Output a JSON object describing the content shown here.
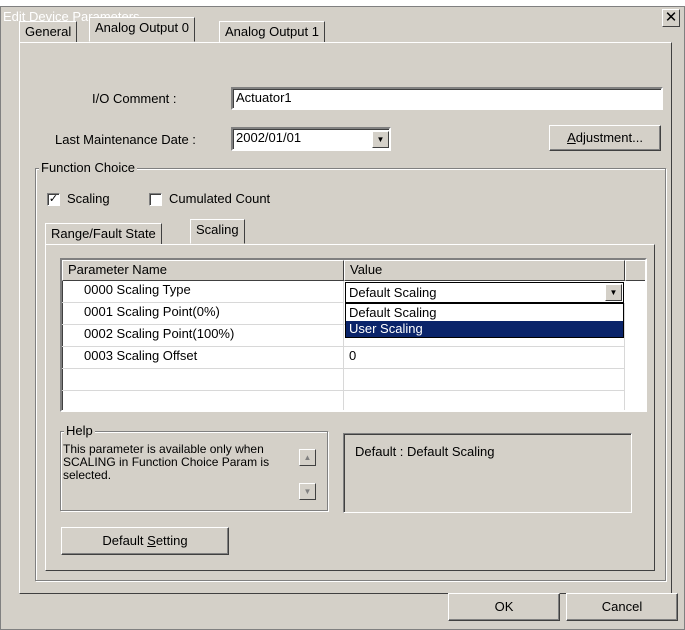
{
  "window": {
    "title": "Edit Device Parameters",
    "close_glyph": "✕"
  },
  "tabs": [
    {
      "label": "General"
    },
    {
      "label": "Analog Output 0"
    },
    {
      "label": "Analog Output 1"
    }
  ],
  "io_comment": {
    "label": "I/O Comment :",
    "value": "Actuator1"
  },
  "maintenance": {
    "label": "Last Maintenance Date :",
    "value": "2002/01/01"
  },
  "adjustment_button": {
    "before": "",
    "accel": "A",
    "after": "djustment..."
  },
  "function_choice": {
    "title": "Function Choice",
    "scaling": {
      "label": "Scaling",
      "checked": true,
      "check_glyph": "✓"
    },
    "cumulated": {
      "label": "Cumulated Count",
      "checked": false
    }
  },
  "subtabs": [
    {
      "label": "Range/Fault State"
    },
    {
      "label": "Scaling"
    }
  ],
  "grid": {
    "headers": [
      "Parameter Name",
      "Value"
    ],
    "rows": [
      {
        "name": "0000 Scaling Type",
        "value": "Default Scaling"
      },
      {
        "name": "0001 Scaling Point(0%)",
        "value": ""
      },
      {
        "name": "0002 Scaling Point(100%)",
        "value": ""
      },
      {
        "name": "0003 Scaling Offset",
        "value": "0"
      }
    ],
    "dropdown_options": [
      "Default Scaling",
      "User Scaling"
    ],
    "highlighted_option": "User Scaling"
  },
  "help": {
    "title": "Help",
    "text": "This parameter is available only when SCALING in Function Choice Param is selected.",
    "default_text": "Default : Default Scaling"
  },
  "default_setting_button": {
    "before": "Default ",
    "accel": "S",
    "after": "etting"
  },
  "ok_button": "OK",
  "cancel_button": "Cancel",
  "colors": {
    "face": "#d4d0c8",
    "highlight": "#0a246a",
    "window": "#ffffff"
  }
}
